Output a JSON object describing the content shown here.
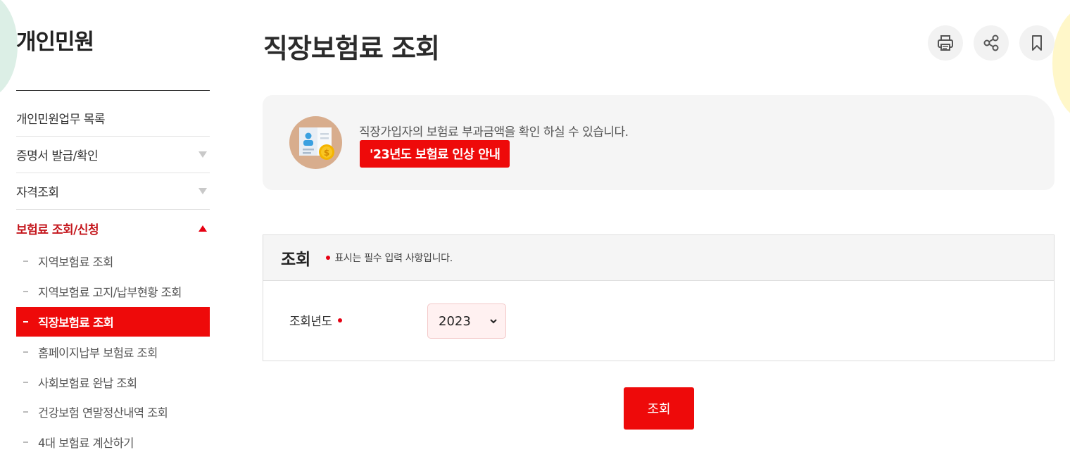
{
  "sidebar": {
    "title": "개인민원",
    "items": [
      {
        "label": "개인민원업무 목록"
      },
      {
        "label": "증명서 발급/확인"
      },
      {
        "label": "자격조회"
      },
      {
        "label": "보험료 조회/신청"
      }
    ],
    "subitems": [
      {
        "label": "지역보험료 조회"
      },
      {
        "label": "지역보험료 고지/납부현황 조회"
      },
      {
        "label": "직장보험료 조회"
      },
      {
        "label": "홈페이지납부 보험료 조회"
      },
      {
        "label": "사회보험료 완납 조회"
      },
      {
        "label": "건강보험 연말정산내역 조회"
      },
      {
        "label": "4대 보험료 계산하기"
      }
    ]
  },
  "header": {
    "title": "직장보험료 조회",
    "tools": [
      "print-icon",
      "share-icon",
      "bookmark-icon"
    ]
  },
  "info": {
    "text": "직장가입자의 보험료 부과금액을 확인 하실 수 있습니다.",
    "notice_button": "'23년도 보험료 인상 안내"
  },
  "form": {
    "title": "조회",
    "required_note": "표시는 필수 입력 사항입니다.",
    "year_label": "조회년도",
    "year_value": "2023",
    "submit_label": "조회"
  },
  "colors": {
    "accent": "#ee0a0a",
    "active_text": "#c4161c",
    "panel_bg": "#f5f5f5"
  }
}
